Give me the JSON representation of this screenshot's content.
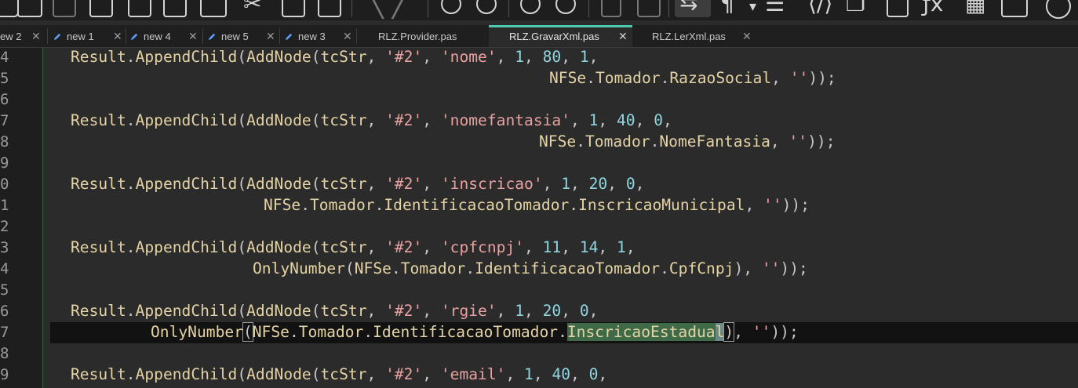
{
  "toolbar": {
    "icons": [
      "open-icon",
      "save-icon",
      "save-all-icon",
      "close-icon",
      "close-all-icon",
      "print-icon",
      "cut-icon",
      "copy-icon",
      "paste-icon",
      "undo-icon",
      "find-icon",
      "replace-icon",
      "zoom-in-icon",
      "zoom-out-icon",
      "sync-scroll-icon",
      "sync-scroll-h-icon",
      "word-wrap-icon",
      "show-all-chars-icon",
      "indent-guide-icon",
      "udl-icon",
      "doc-map-icon",
      "function-list-icon",
      "folder-workspace-icon",
      "monitoring-icon",
      "record-macro-icon"
    ]
  },
  "tabs": [
    {
      "label": "ew 2",
      "modified": true
    },
    {
      "label": "new 1",
      "modified": true
    },
    {
      "label": "new 4",
      "modified": true
    },
    {
      "label": "new 5",
      "modified": true
    },
    {
      "label": "new 3",
      "modified": true
    },
    {
      "label": "RLZ.Provider.pas",
      "modified": false
    },
    {
      "label": "RLZ.GravarXml.pas",
      "modified": false,
      "active": true
    },
    {
      "label": "RLZ.LerXml.pas",
      "modified": false
    }
  ],
  "tab_close_glyph": "✕",
  "line_numbers": [
    "4",
    "5",
    "6",
    "7",
    "8",
    "9",
    "0",
    "1",
    "2",
    "3",
    "4",
    "5",
    "6",
    "7",
    "8",
    "9"
  ],
  "code": {
    "l0": {
      "a": "Result",
      "b": ".",
      "c": "AppendChild",
      "d": "(",
      "e": "AddNode",
      "f": "(",
      "g": "tcStr",
      ",1": ", ",
      "s1": "'#2'",
      ",2": ", ",
      "s2": "'nome'",
      ",3": ", ",
      "n1": "1",
      ",4": ", ",
      "n2": "80",
      ",5": ", ",
      "n3": "1",
      ",6": ","
    },
    "l1": {
      "a": "NFSe",
      "b": ".",
      "c": "Tomador",
      "d": ".",
      "e": "RazaoSocial",
      ",1": ", ",
      "s1": "''",
      "z": "));"
    },
    "l3": {
      "a": "Result",
      "b": ".",
      "c": "AppendChild",
      "d": "(",
      "e": "AddNode",
      "f": "(",
      "g": "tcStr",
      ",1": ", ",
      "s1": "'#2'",
      ",2": ", ",
      "s2": "'nomefantasia'",
      ",3": ", ",
      "n1": "1",
      ",4": ", ",
      "n2": "40",
      ",5": ", ",
      "n3": "0",
      ",6": ","
    },
    "l4": {
      "a": "NFSe",
      "b": ".",
      "c": "Tomador",
      "d": ".",
      "e": "NomeFantasia",
      ",1": ", ",
      "s1": "''",
      "z": "));"
    },
    "l6": {
      "a": "Result",
      "b": ".",
      "c": "AppendChild",
      "d": "(",
      "e": "AddNode",
      "f": "(",
      "g": "tcStr",
      ",1": ", ",
      "s1": "'#2'",
      ",2": ", ",
      "s2": "'inscricao'",
      ",3": ", ",
      "n1": "1",
      ",4": ", ",
      "n2": "20",
      ",5": ", ",
      "n3": "0",
      ",6": ","
    },
    "l7": {
      "a": "NFSe",
      "b": ".",
      "c": "Tomador",
      "d": ".",
      "e": "IdentificacaoTomador",
      "f": ".",
      "g": "InscricaoMunicipal",
      ",1": ", ",
      "s1": "''",
      "z": "));"
    },
    "l9": {
      "a": "Result",
      "b": ".",
      "c": "AppendChild",
      "d": "(",
      "e": "AddNode",
      "f": "(",
      "g": "tcStr",
      ",1": ", ",
      "s1": "'#2'",
      ",2": ", ",
      "s2": "'cpfcnpj'",
      ",3": ", ",
      "n1": "11",
      ",4": ", ",
      "n2": "14",
      ",5": ", ",
      "n3": "1",
      ",6": ","
    },
    "l10": {
      "a": "OnlyNumber",
      "b": "(",
      "c": "NFSe",
      "d": ".",
      "e": "Tomador",
      "f": ".",
      "g": "IdentificacaoTomador",
      "h": ".",
      "i": "CpfCnpj",
      "j": ")",
      ",1": ", ",
      "s1": "''",
      "z": "));"
    },
    "l12": {
      "a": "Result",
      "b": ".",
      "c": "AppendChild",
      "d": "(",
      "e": "AddNode",
      "f": "(",
      "g": "tcStr",
      ",1": ", ",
      "s1": "'#2'",
      ",2": ", ",
      "s2": "'rgie'",
      ",3": ", ",
      "n1": "1",
      ",4": ", ",
      "n2": "20",
      ",5": ", ",
      "n3": "0",
      ",6": ","
    },
    "l13": {
      "a": "OnlyNumber",
      "b": "(",
      "c": "NFSe",
      "d": ".",
      "e": "Tomador",
      "f": ".",
      "g": "IdentificacaoTomador",
      "h": ".",
      "i": "InscricaoEstadua",
      "i2": "l",
      "j": ")",
      ",1": ", ",
      "s1": "''",
      "z": "));"
    },
    "l15": {
      "a": "Result",
      "b": ".",
      "c": "AppendChild",
      "d": "(",
      "e": "AddNode",
      "f": "(",
      "g": "tcStr",
      ",1": ", ",
      "s1": "'#2'",
      ",2": ", ",
      "s2": "'email'",
      ",3": ", ",
      "n1": "1",
      ",4": ", ",
      "n2": "40",
      ",5": ", ",
      "n3": "0",
      ",6": ","
    }
  }
}
